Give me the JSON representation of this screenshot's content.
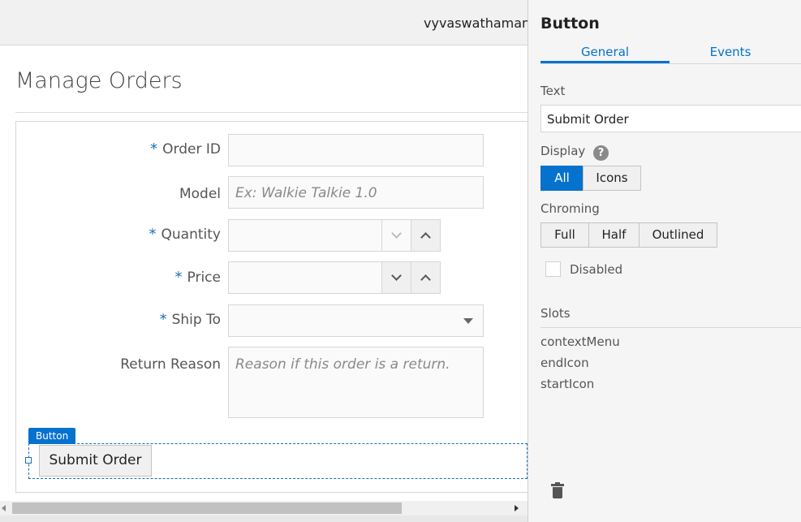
{
  "header": {
    "username": "vyvaswathamanu"
  },
  "page": {
    "title": "Manage Orders"
  },
  "form": {
    "order_id": {
      "label": "Order ID",
      "required_mark": "*",
      "value": ""
    },
    "model": {
      "label": "Model",
      "placeholder": "Ex: Walkie Talkie 1.0"
    },
    "quantity": {
      "label": "Quantity",
      "required_mark": "*",
      "value": ""
    },
    "price": {
      "label": "Price",
      "required_mark": "*",
      "value": ""
    },
    "ship_to": {
      "label": "Ship To",
      "required_mark": "*",
      "value": ""
    },
    "return_reason": {
      "label": "Return Reason",
      "placeholder": "Reason if this order is a return."
    }
  },
  "selection": {
    "tag_label": "Button"
  },
  "submit_button": {
    "label": "Submit Order"
  },
  "panel": {
    "title": "Button",
    "tabs": [
      {
        "label": "General",
        "active": true
      },
      {
        "label": "Events",
        "active": false
      }
    ],
    "text": {
      "label": "Text",
      "value": "Submit Order"
    },
    "display": {
      "label": "Display",
      "help_icon": "?",
      "options": [
        "All",
        "Icons"
      ],
      "selected": "All"
    },
    "chroming": {
      "label": "Chroming",
      "options": [
        "Full",
        "Half",
        "Outlined"
      ]
    },
    "disabled": {
      "label": "Disabled",
      "checked": false
    },
    "slots": {
      "label": "Slots",
      "items": [
        "contextMenu",
        "endIcon",
        "startIcon"
      ]
    }
  },
  "colors": {
    "accent": "#0572ce",
    "required": "#1c6fb8"
  }
}
